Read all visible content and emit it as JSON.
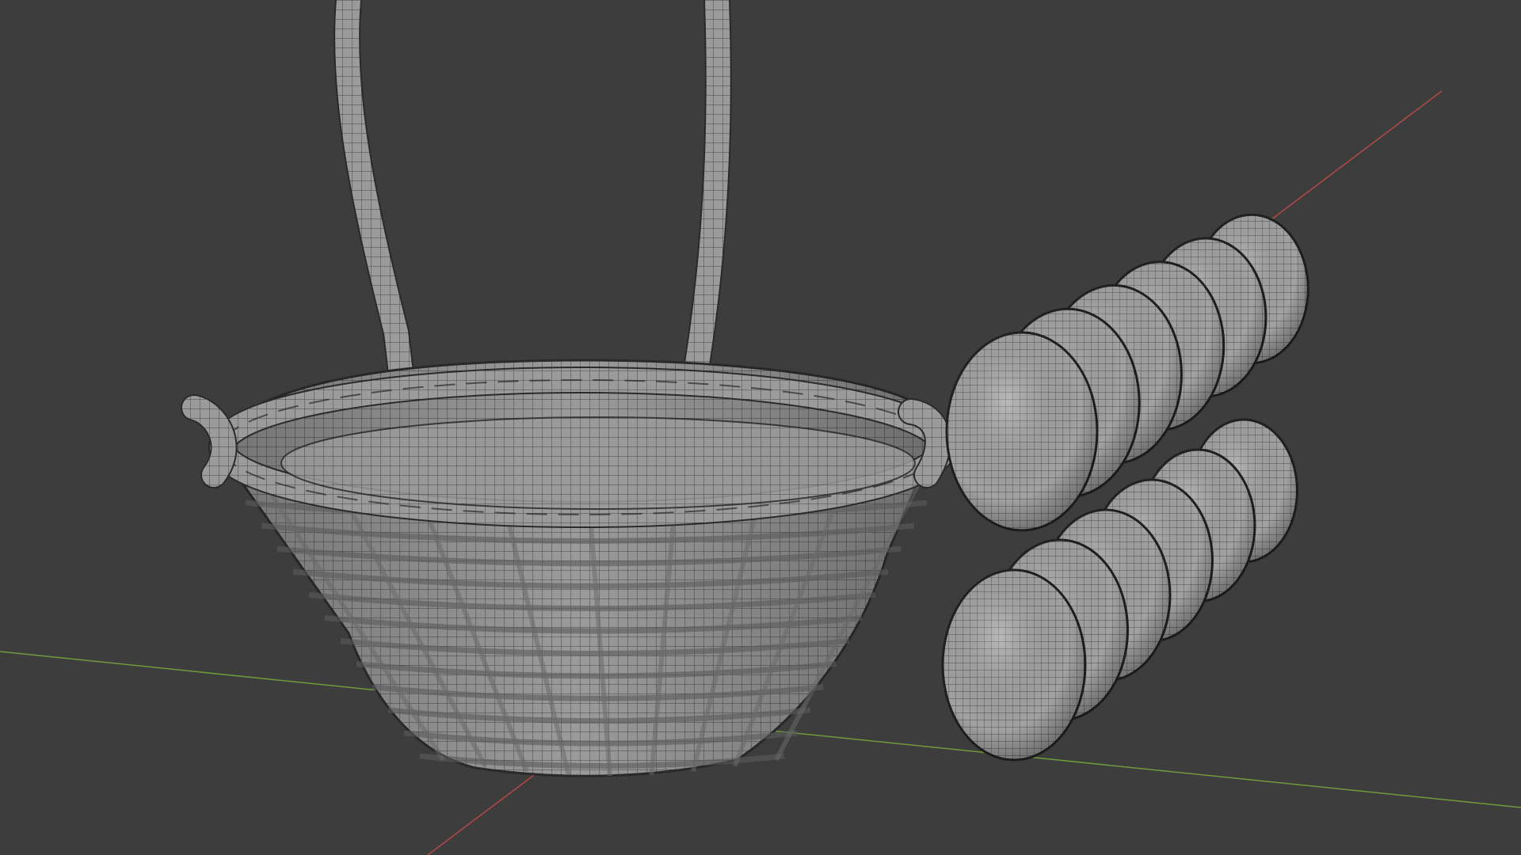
{
  "app": "3D viewport",
  "viewport": {
    "background": "#3d3d3d",
    "x_axis_color": "#b04a4a",
    "y_axis_color": "#6f9a3a",
    "mesh_fill": "#9a9a9a",
    "mesh_wire": "#2a2a2a"
  },
  "objects": [
    {
      "name": "wicker-basket",
      "type": "mesh"
    },
    {
      "name": "basket-handle",
      "type": "mesh"
    },
    {
      "name": "egg-row-upper",
      "type": "mesh",
      "count": 6
    },
    {
      "name": "egg-row-lower",
      "type": "mesh",
      "count": 6
    }
  ]
}
